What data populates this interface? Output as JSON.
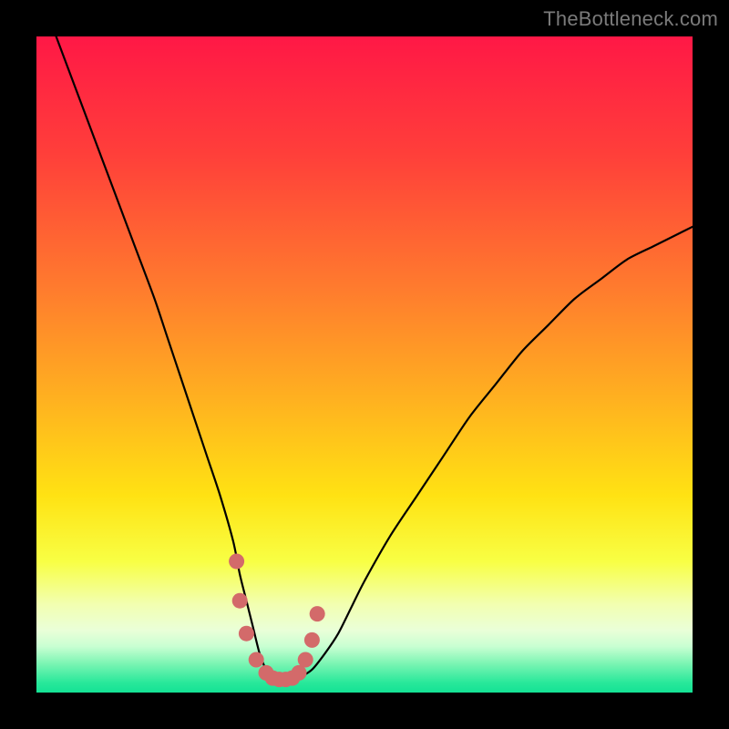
{
  "watermark": "TheBottleneck.com",
  "colors": {
    "background": "#000000",
    "curve_stroke": "#000000",
    "highlight_marker": "#d36a6a",
    "gradient_stops": [
      {
        "offset": 0.0,
        "color": "#ff1846"
      },
      {
        "offset": 0.18,
        "color": "#ff3f3a"
      },
      {
        "offset": 0.38,
        "color": "#ff7a2e"
      },
      {
        "offset": 0.55,
        "color": "#ffb020"
      },
      {
        "offset": 0.7,
        "color": "#ffe213"
      },
      {
        "offset": 0.8,
        "color": "#f8ff44"
      },
      {
        "offset": 0.865,
        "color": "#f2ffb0"
      },
      {
        "offset": 0.905,
        "color": "#eaffd8"
      },
      {
        "offset": 0.93,
        "color": "#c8ffd2"
      },
      {
        "offset": 0.955,
        "color": "#7ef5b4"
      },
      {
        "offset": 0.985,
        "color": "#28e89a"
      },
      {
        "offset": 1.0,
        "color": "#14e295"
      }
    ]
  },
  "chart_data": {
    "type": "line",
    "title": "",
    "xlabel": "",
    "ylabel": "",
    "xlim": [
      0,
      100
    ],
    "ylim": [
      0,
      100
    ],
    "legend": false,
    "grid": false,
    "series": [
      {
        "name": "bottleneck-curve",
        "x": [
          3,
          6,
          9,
          12,
          15,
          18,
          20,
          22,
          24,
          26,
          28,
          30,
          31,
          32,
          33,
          34,
          35,
          36,
          37,
          38,
          40,
          42,
          44,
          46,
          48,
          50,
          54,
          58,
          62,
          66,
          70,
          74,
          78,
          82,
          86,
          90,
          94,
          98,
          100
        ],
        "y": [
          100,
          92,
          84,
          76,
          68,
          60,
          54,
          48,
          42,
          36,
          30,
          23,
          18,
          14,
          10,
          6,
          3.5,
          2.2,
          2.0,
          2.0,
          2.3,
          3.5,
          6,
          9,
          13,
          17,
          24,
          30,
          36,
          42,
          47,
          52,
          56,
          60,
          63,
          66,
          68,
          70,
          71
        ]
      }
    ],
    "highlighted_points": {
      "name": "near-optimal-markers",
      "x": [
        30.5,
        31.0,
        32.0,
        33.5,
        35.0,
        36.0,
        37.0,
        38.0,
        39.0,
        40.0,
        41.0,
        42.0,
        42.8
      ],
      "y": [
        20,
        14,
        9,
        5,
        3,
        2.2,
        2.0,
        2.0,
        2.2,
        3.0,
        5.0,
        8.0,
        12.0
      ]
    },
    "annotations": []
  }
}
